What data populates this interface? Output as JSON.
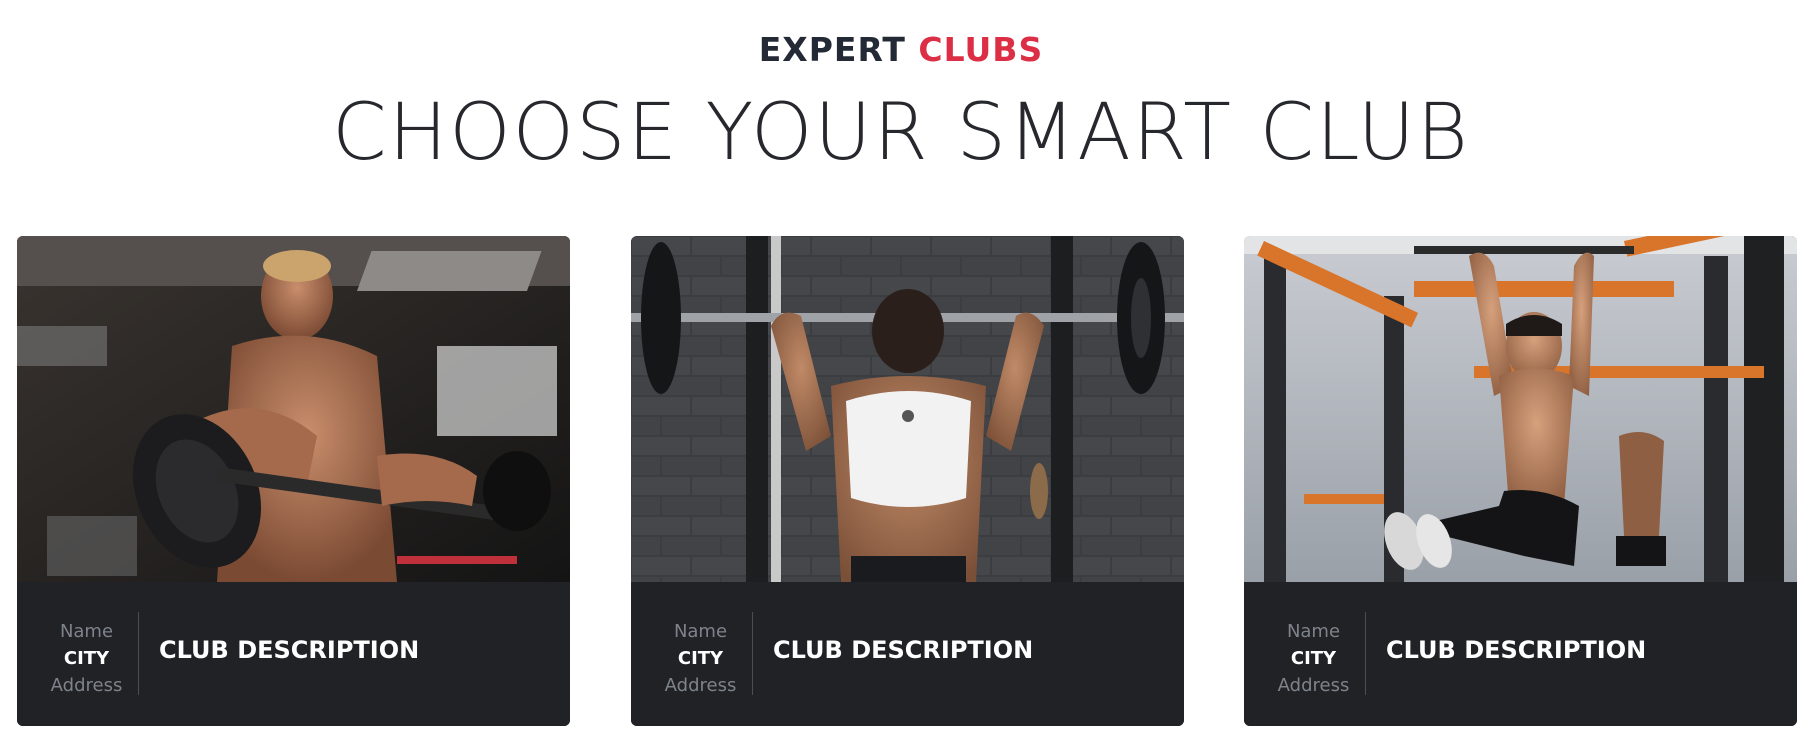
{
  "header": {
    "eyebrow_part1": "EXPERT",
    "eyebrow_part2": "CLUBS",
    "title": "CHOOSE YOUR SMART CLUB",
    "accent_color": "#dc2f45",
    "dark_color": "#232a36"
  },
  "clubs": [
    {
      "photo_icon": "gym-photo-curl",
      "name_label": "Name",
      "city_label": "CITY",
      "address_label": "Address",
      "description": "CLUB DESCRIPTION"
    },
    {
      "photo_icon": "gym-photo-overhead-press",
      "name_label": "Name",
      "city_label": "CITY",
      "address_label": "Address",
      "description": "CLUB DESCRIPTION"
    },
    {
      "photo_icon": "gym-photo-pullup",
      "name_label": "Name",
      "city_label": "CITY",
      "address_label": "Address",
      "description": "CLUB DESCRIPTION"
    }
  ]
}
